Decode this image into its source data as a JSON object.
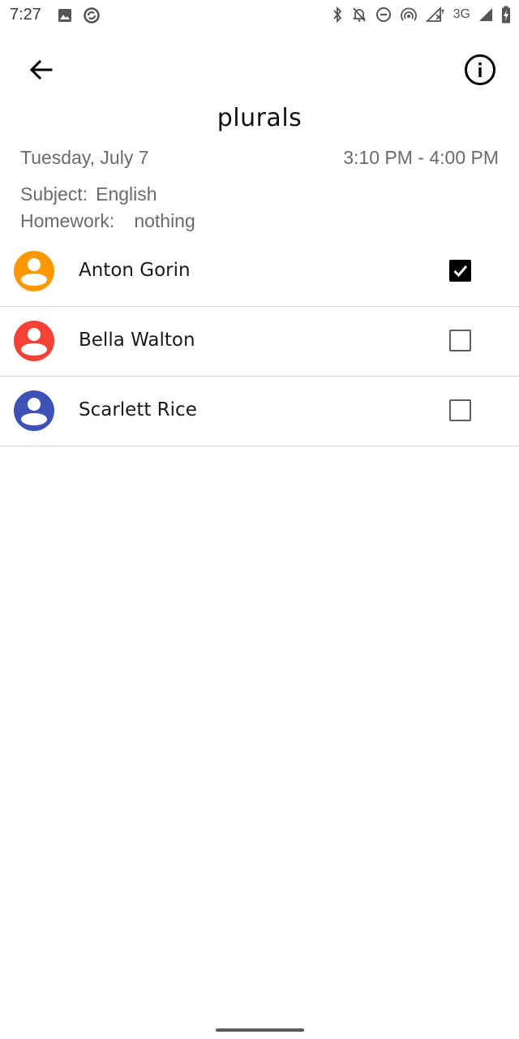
{
  "status_bar": {
    "time": "7:27",
    "network": "3G",
    "left_icons": [
      "image-icon",
      "sync-circle-icon"
    ],
    "right_icons": [
      "bluetooth-icon",
      "bell-off-icon",
      "do-not-disturb-icon",
      "hotspot-icon",
      "signal-off-icon",
      "cell-signal-icon",
      "battery-charging-icon"
    ]
  },
  "toolbar": {
    "back_icon": "arrow-back-icon",
    "info_icon": "info-icon",
    "title": "plurals"
  },
  "lesson": {
    "date": "Tuesday, July 7",
    "time_range": "3:10 PM - 4:00 PM",
    "subject_label": "Subject:",
    "subject_value": "English",
    "homework_label": "Homework:",
    "homework_value": "nothing"
  },
  "students": [
    {
      "name": "Anton Gorin",
      "avatar_color": "#FF9800",
      "checked": true
    },
    {
      "name": "Bella Walton",
      "avatar_color": "#F44336",
      "checked": false
    },
    {
      "name": "Scarlett Rice",
      "avatar_color": "#3F51B5",
      "checked": false
    }
  ]
}
